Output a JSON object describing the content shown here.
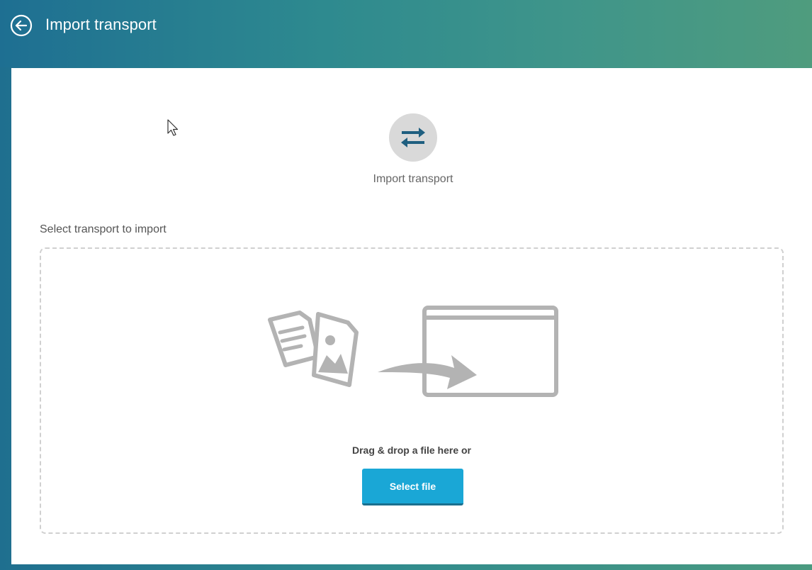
{
  "header": {
    "title": "Import transport",
    "back_icon": "back-arrow-circle-icon"
  },
  "step": {
    "icon": "transfer-arrows-icon",
    "label": "Import transport"
  },
  "upload": {
    "section_label": "Select transport to import",
    "illustration": "files-to-window-icon",
    "drop_text": "Drag & drop a file here or",
    "button_label": "Select file"
  },
  "colors": {
    "header_start": "#1e6f92",
    "header_end": "#4f9c7e",
    "button": "#1aa7d6",
    "icon_circle": "#d9d9d9",
    "icon_arrows": "#1f5f80"
  }
}
